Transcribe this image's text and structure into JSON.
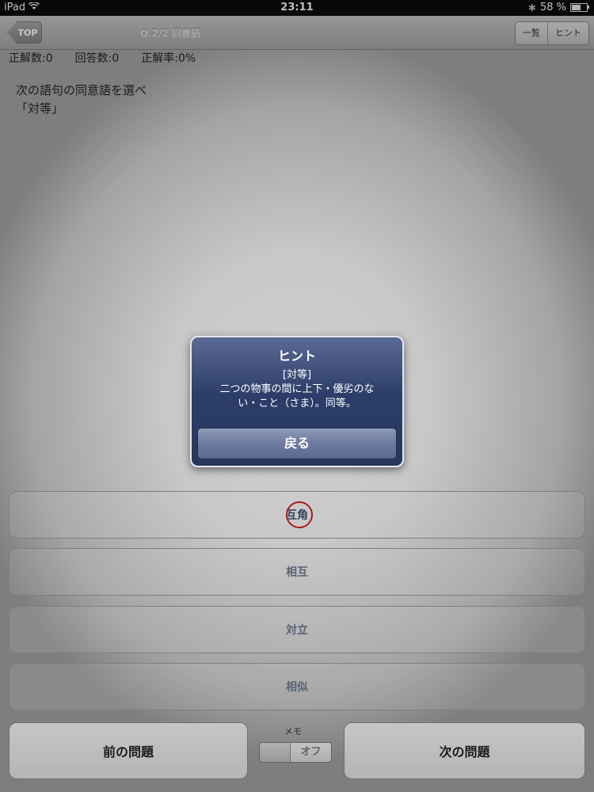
{
  "status_bar": {
    "device": "iPad",
    "time": "23:11",
    "battery": "58 %"
  },
  "nav": {
    "back_label": "TOP",
    "title": "Q.2/2 同意語",
    "segments": [
      "一覧",
      "ヒント"
    ]
  },
  "stats": {
    "correct": "正解数:0",
    "answered": "回答数:0",
    "rate": "正解率:0%"
  },
  "question": {
    "prompt": "次の語句の同意語を選べ",
    "word": "「対等」"
  },
  "choices": [
    "互角",
    "相互",
    "対立",
    "相似"
  ],
  "footer": {
    "prev": "前の問題",
    "next": "次の問題",
    "memo_label": "メモ",
    "memo_state": "オフ"
  },
  "alert": {
    "title": "ヒント",
    "line1": "[対等]",
    "line2": "二つの物事の間に上下・優劣のな",
    "line3": "い・こと（さま）。同等。",
    "button": "戻る"
  },
  "colors": {
    "alert_bg": "#2c3d69",
    "mark": "#cc2222"
  }
}
